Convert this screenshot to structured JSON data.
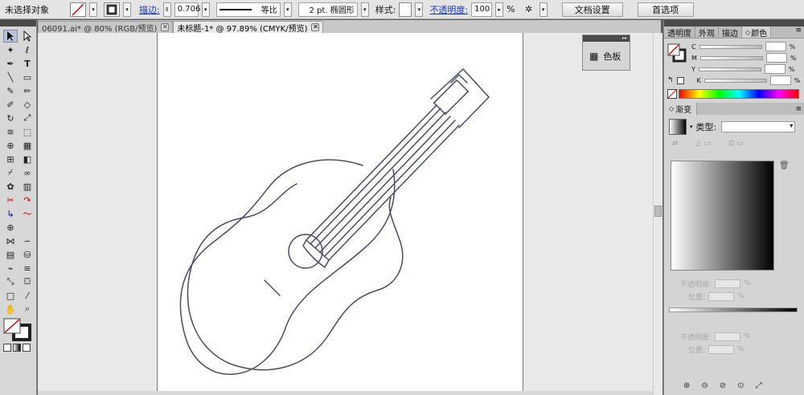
{
  "control_bar": {
    "selection_label": "未选择对象",
    "stroke_label": "描边:",
    "stroke_value": "0.706",
    "stroke_profile": "等比",
    "brush_value": "2 pt. 椭圆形",
    "style_label": "样式:",
    "opacity_label": "不透明度:",
    "opacity_value": "100",
    "opacity_unit": "%",
    "doc_setup_button": "文档设置",
    "preferences_button": "首选项"
  },
  "tabs": [
    {
      "label": "06091.ai* @ 80% (RGB/预览)",
      "active": false
    },
    {
      "label": "未标题-1* @ 97.89% (CMYK/预览)",
      "active": true
    }
  ],
  "tab_close": "✕",
  "floating_panel": {
    "label": "色板"
  },
  "right_panel": {
    "tabs": [
      "透明度",
      "外观",
      "描边",
      "颜色"
    ],
    "active_tab": "颜色",
    "cmyk_labels": [
      "C",
      "M",
      "Y",
      "K"
    ],
    "cmyk_units": [
      "%",
      "%",
      "%",
      "%"
    ]
  },
  "gradient_panel": {
    "tab": "渐变",
    "type_label": "类型:",
    "opacity_label": "不透明度:",
    "position_label": "位置:",
    "percent": "%"
  },
  "colors": {
    "ui_bg": "#e4e4e4",
    "panel_header": "#4a4a4a",
    "link_blue": "#1a35c9",
    "guitar_stroke": "#4b4a66",
    "canvas_bg": "#e9e9e9"
  }
}
